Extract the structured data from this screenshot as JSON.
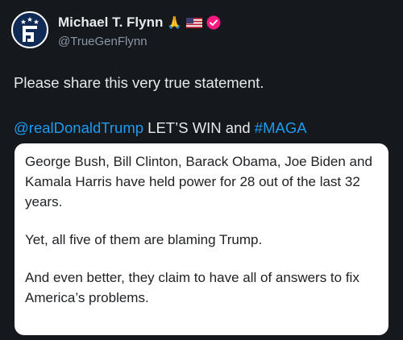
{
  "author": {
    "display_name": "Michael T. Flynn",
    "handle": "@TrueGenFlynn",
    "avatar_icon": "gf-star-logo",
    "badges": [
      "folded-hands-emoji",
      "us-flag-emoji",
      "verified-badge"
    ]
  },
  "tweet": {
    "text_line1": "Please share this very true statement.",
    "mention": "@realDonaldTrump",
    "middle_text": " LET’S WIN and ",
    "hashtag": "#MAGA"
  },
  "quote_image": {
    "paragraph1": "George Bush, Bill Clinton, Barack Obama, Joe Biden and Kamala Harris have held power for 28 out of the last 32 years.",
    "paragraph2": "Yet, all five of them are blaming Trump.",
    "paragraph3": "And even better, they claim to have all of answers to fix America’s problems."
  },
  "colors": {
    "background": "#15181c",
    "link": "#1d9bf0",
    "verified": "#f91880",
    "secondary_text": "#8b98a5"
  }
}
